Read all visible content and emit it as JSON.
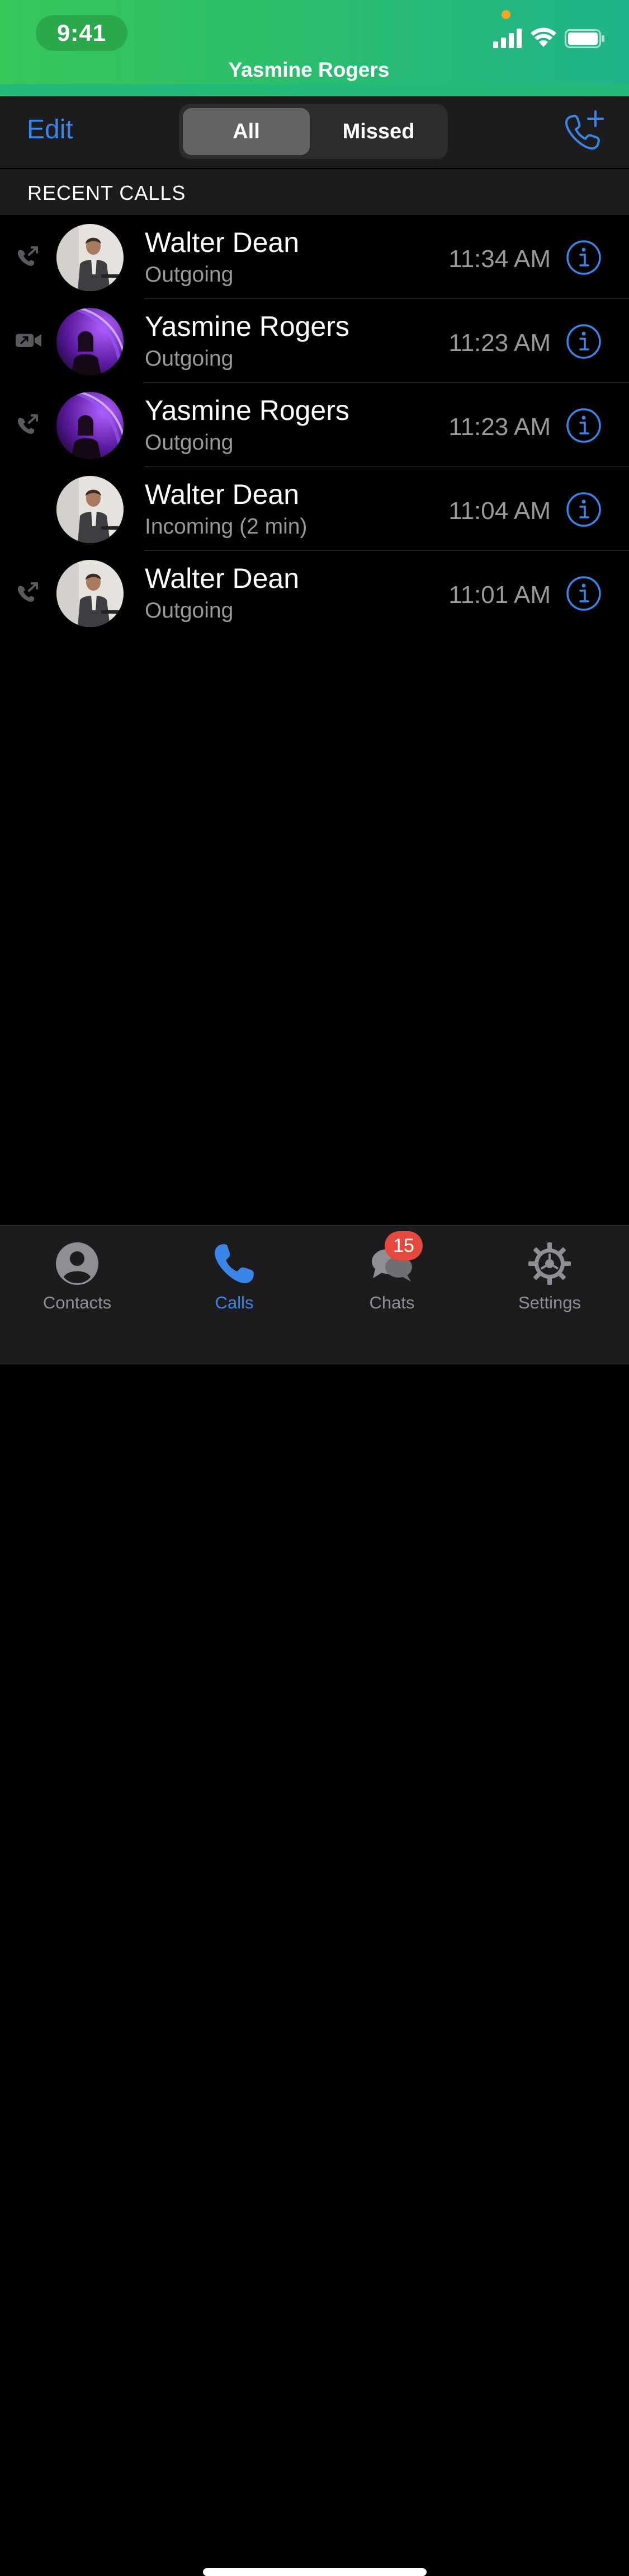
{
  "status_bar": {
    "time": "9:41",
    "accent_dot_color": "#f5a623",
    "icons": [
      "signal-icon",
      "wifi-icon",
      "battery-icon"
    ]
  },
  "banner": {
    "title": "Yasmine Rogers",
    "color": "#2cbe6b"
  },
  "nav": {
    "edit_label": "Edit",
    "segments": [
      {
        "label": "All",
        "selected": true
      },
      {
        "label": "Missed",
        "selected": false
      }
    ],
    "new_call_icon": "phone-plus-icon"
  },
  "section": {
    "title": "RECENT CALLS"
  },
  "calls": [
    {
      "name": "Walter Dean",
      "detail": "Outgoing",
      "time": "11:34 AM",
      "type_icon": "outgoing-call-icon",
      "avatar": "walter"
    },
    {
      "name": "Yasmine Rogers",
      "detail": "Outgoing",
      "time": "11:23 AM",
      "type_icon": "video-call-icon",
      "avatar": "yasmine"
    },
    {
      "name": "Yasmine Rogers",
      "detail": "Outgoing",
      "time": "11:23 AM",
      "type_icon": "outgoing-call-icon",
      "avatar": "yasmine"
    },
    {
      "name": "Walter Dean",
      "detail": "Incoming (2 min)",
      "time": "11:04 AM",
      "type_icon": "",
      "avatar": "walter"
    },
    {
      "name": "Walter Dean",
      "detail": "Outgoing",
      "time": "11:01 AM",
      "type_icon": "outgoing-call-icon",
      "avatar": "walter"
    }
  ],
  "tabs": [
    {
      "label": "Contacts",
      "icon": "person-circle-icon",
      "active": false
    },
    {
      "label": "Calls",
      "icon": "phone-icon",
      "active": true
    },
    {
      "label": "Chats",
      "icon": "chat-bubbles-icon",
      "active": false,
      "badge": "15"
    },
    {
      "label": "Settings",
      "icon": "gear-icon",
      "active": false
    }
  ],
  "colors": {
    "accent": "#3a86e8",
    "badge": "#e5493d",
    "background": "#000000",
    "bar": "#1c1c1e"
  }
}
